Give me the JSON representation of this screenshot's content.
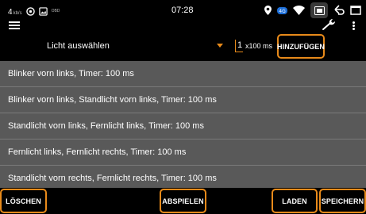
{
  "status_bar": {
    "speed": "4",
    "speed_unit": "kb/s",
    "obd_label": "OBD",
    "time": "07:28",
    "icons": [
      "message-icon",
      "image-icon",
      "location-icon",
      "network-badge-icon",
      "wifi-icon",
      "screenshot-icon",
      "back-icon",
      "window-icon"
    ]
  },
  "toolbar": {
    "menu_icon": "hamburger-menu-icon",
    "settings_icon": "wrench-icon",
    "overflow_icon": "more-vertical-icon"
  },
  "selector": {
    "label": "Licht auswählen",
    "duration_value": "1",
    "duration_unit": "x100 ms",
    "add_label": "HINZUFÜGEN",
    "accent_color": "#e88a1a"
  },
  "sequence": {
    "items": [
      "Blinker vorn links,  Timer: 100 ms",
      "Blinker vorn links, Standlicht vorn links,  Timer: 100 ms",
      "Standlicht vorn links, Fernlicht links,  Timer: 100 ms",
      "Fernlicht links, Fernlicht rechts,  Timer: 100 ms",
      "Standlicht vorn rechts, Fernlicht rechts,  Timer: 100 ms"
    ]
  },
  "actions": {
    "delete_label": "LÖSCHEN",
    "play_label": "ABSPIELEN",
    "load_label": "LADEN",
    "save_label": "SPEICHERN"
  }
}
